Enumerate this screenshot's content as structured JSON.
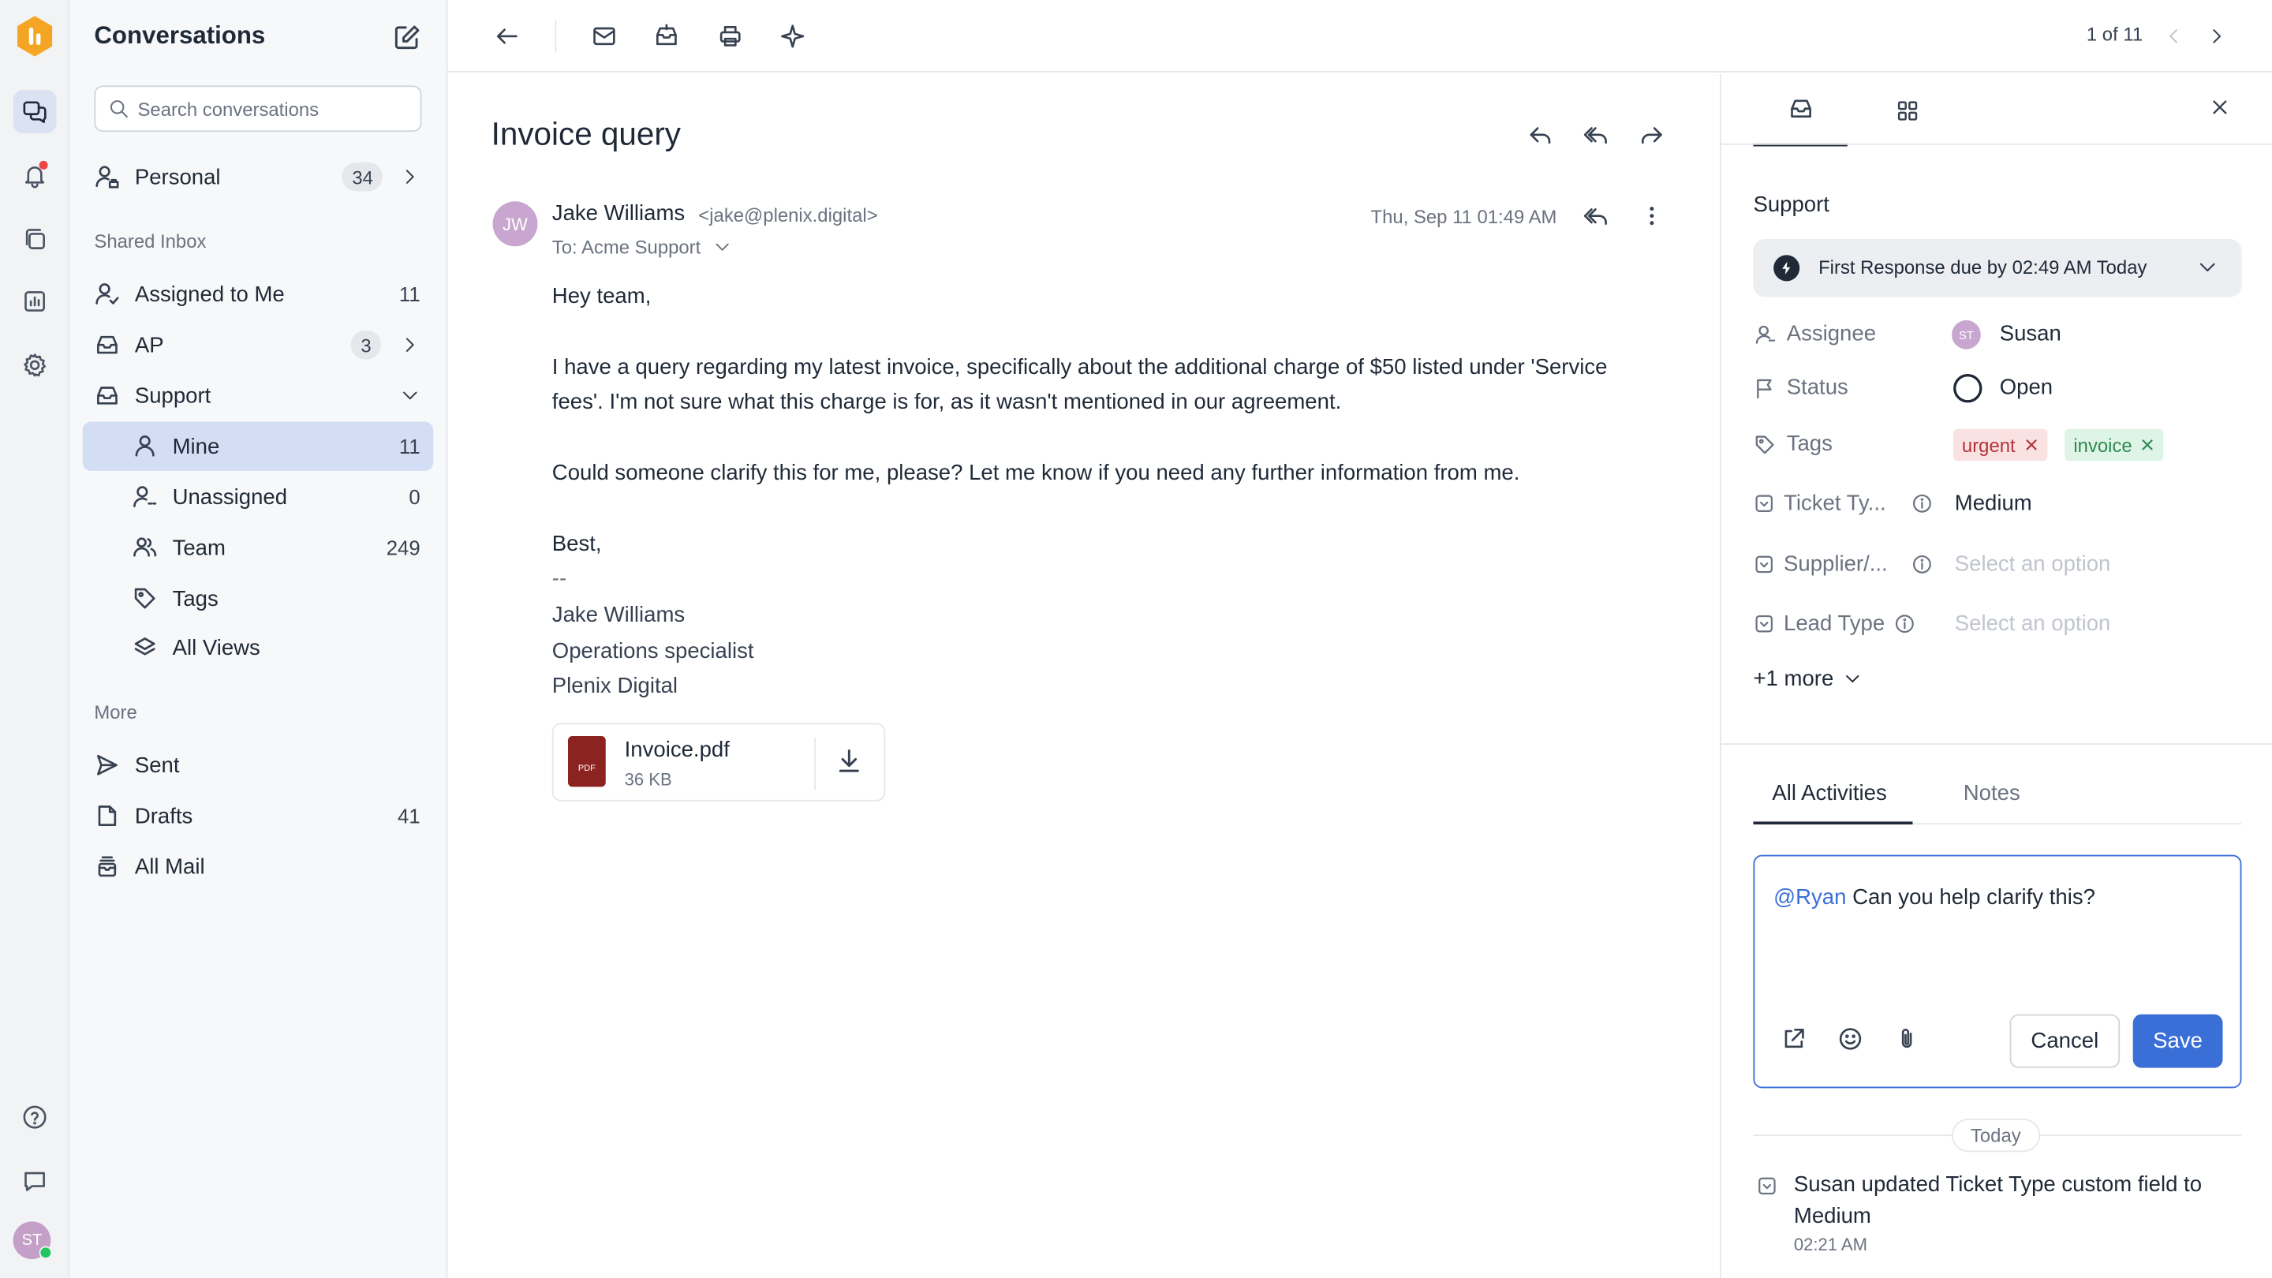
{
  "sidebar": {
    "title": "Conversations",
    "search_placeholder": "Search conversations",
    "personal": {
      "label": "Personal",
      "count": "34"
    },
    "shared_section": "Shared Inbox",
    "assigned": {
      "label": "Assigned to Me",
      "count": "11"
    },
    "ap": {
      "label": "AP",
      "count": "3"
    },
    "support": {
      "label": "Support"
    },
    "mine": {
      "label": "Mine",
      "count": "11"
    },
    "unassigned": {
      "label": "Unassigned",
      "count": "0"
    },
    "team": {
      "label": "Team",
      "count": "249"
    },
    "tags": {
      "label": "Tags"
    },
    "all_views": {
      "label": "All Views"
    },
    "more_section": "More",
    "sent": {
      "label": "Sent"
    },
    "drafts": {
      "label": "Drafts",
      "count": "41"
    },
    "all_mail": {
      "label": "All Mail"
    }
  },
  "rail": {
    "avatar_initials": "ST"
  },
  "toolbar": {
    "pager": "1 of 11"
  },
  "message": {
    "subject": "Invoice query",
    "avatar_initials": "JW",
    "from_name": "Jake Williams",
    "from_email": "<jake@plenix.digital>",
    "to": "To: Acme Support",
    "date": "Thu, Sep 11 01:49 AM",
    "greeting": "Hey team,",
    "para1": "I have a query regarding my latest invoice, specifically about the additional charge of $50 listed under 'Service fees'. I'm not sure what this charge is for, as it wasn't mentioned in our agreement.",
    "para2": "Could someone clarify this for me, please? Let me know if you need any further information from me.",
    "closing": "Best,",
    "dashes": "--",
    "sig_name": "Jake Williams",
    "sig_title": "Operations specialist",
    "sig_company": "Plenix Digital",
    "attachment": {
      "name": "Invoice.pdf",
      "size": "36 KB",
      "badge": "PDF"
    }
  },
  "panel": {
    "team": "Support",
    "sla": "First Response due by 02:49 AM Today",
    "assignee_label": "Assignee",
    "assignee_initials": "ST",
    "assignee_value": "Susan",
    "status_label": "Status",
    "status_value": "Open",
    "tags_label": "Tags",
    "tags": [
      "urgent",
      "invoice"
    ],
    "ticket_label": "Ticket Ty...",
    "ticket_value": "Medium",
    "supplier_label": "Supplier/...",
    "supplier_placeholder": "Select an option",
    "lead_label": "Lead Type",
    "lead_placeholder": "Select an option",
    "more": "+1 more",
    "tab_activities": "All Activities",
    "tab_notes": "Notes",
    "note_mention": "@Ryan",
    "note_text": " Can you help clarify this?",
    "cancel": "Cancel",
    "save": "Save",
    "day_label": "Today",
    "log_text": "Susan updated Ticket Type custom field to Medium",
    "log_time": "02:21 AM"
  },
  "colors": {
    "accent": "#3b6fd8",
    "selected_nav": "#d3def5",
    "urgent_bg": "#fbe2e2",
    "invoice_bg": "#def4e6"
  }
}
